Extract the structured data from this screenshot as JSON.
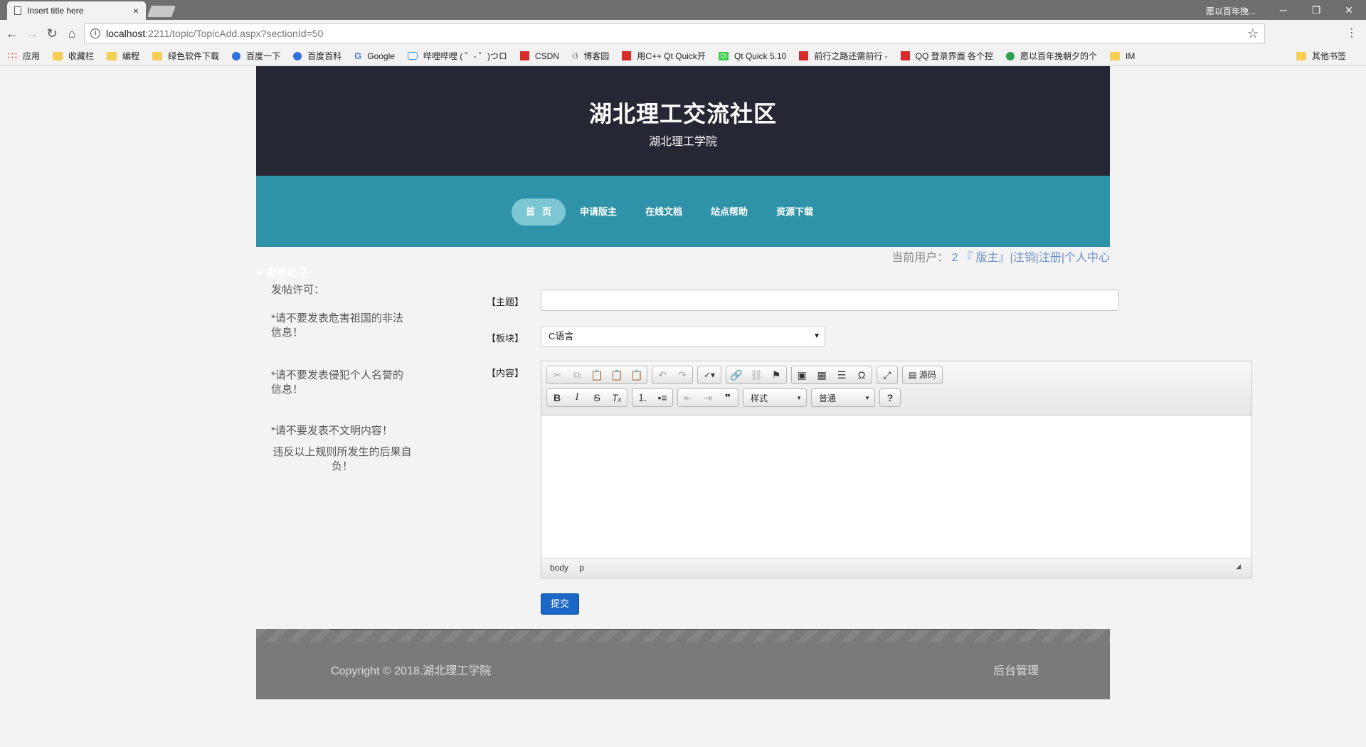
{
  "browser": {
    "tab_title": "Insert title here",
    "tab_close": "×",
    "window_user": "愿以百年挽...",
    "url_host": "localhost",
    "url_path": ":2211/topic/TopicAdd.aspx?sectionId=50",
    "bookmarks": [
      "应用",
      "收藏栏",
      "编程",
      "绿色软件下载",
      "百度一下",
      "百度百科",
      "Google",
      "哔哩哔哩 ( ゜- ゜)つロ",
      "CSDN",
      "博客园",
      "用C++ Qt Quick开",
      "Qt Quick 5.10",
      "前行之路还需前行 -",
      "QQ 登录界面 各个控",
      "愿以百年挽朝夕的个",
      "IM"
    ],
    "other_bookmarks": "其他书签"
  },
  "header": {
    "title": "湖北理工交流社区",
    "subtitle": "湖北理工学院"
  },
  "nav": {
    "items": [
      "首页",
      "申请版主",
      "在线文档",
      "站点帮助",
      "资源下载"
    ]
  },
  "userbar": {
    "prefix": "当前用户：",
    "username": "2",
    "role": "『 版主』",
    "logout": "|注销",
    "register": "|注册",
    "center": "|个人中心"
  },
  "post": {
    "section_title": "发表帖子",
    "rules_title": "发帖许可：",
    "rule1": "*请不要发表危害祖国的非法信息！",
    "rule2": "*请不要发表侵犯个人名誉的信息！",
    "rule3": "*请不要发表不文明内容！",
    "rule4": "违反以上规则所发生的后果自负！"
  },
  "form": {
    "subject_label": "【主题】",
    "section_label": "【板块】",
    "content_label": "【内容】",
    "section_value": "C语言",
    "submit": "提交"
  },
  "editor": {
    "source_label": "源码",
    "style_combo": "样式",
    "format_combo": "普通",
    "path": [
      "body",
      "p"
    ]
  },
  "footer": {
    "copyright": "Copyright © 2018.湖北理工学院",
    "admin": "后台管理"
  }
}
